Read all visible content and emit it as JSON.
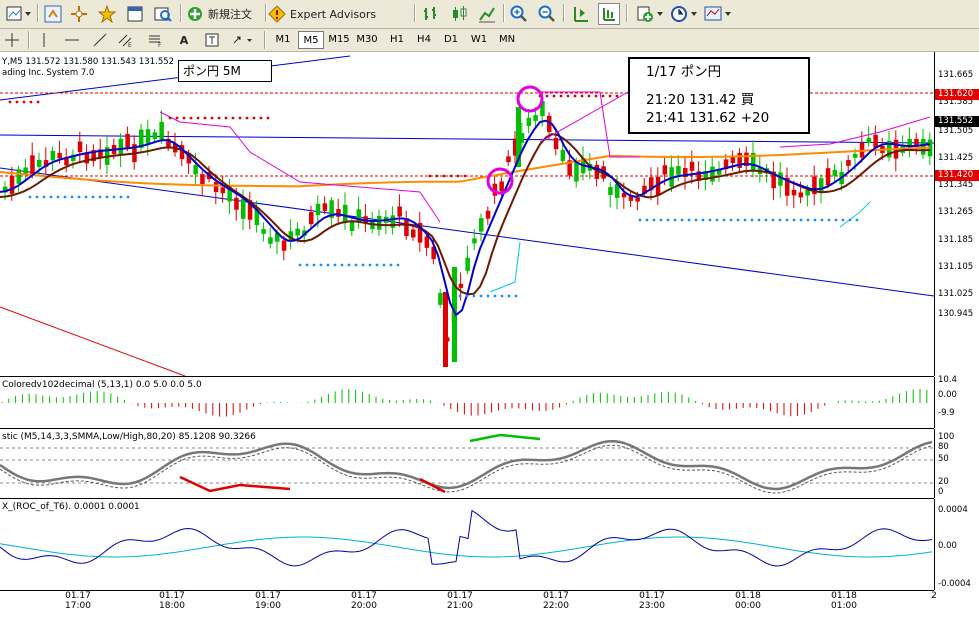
{
  "toolbar": {
    "new_order_label": "新規注文",
    "expert_advisors_label": "Expert Advisors",
    "timeframes": [
      "M1",
      "M5",
      "M15",
      "M30",
      "H1",
      "H4",
      "D1",
      "W1",
      "MN"
    ],
    "active_timeframe": "M5"
  },
  "chart": {
    "header_text": "Y,M5  131.572 131.580 131.543 131.552",
    "subheader_text": "ading Inc. System 7.0",
    "label_box": "ポン円  5M",
    "note_title": "1/17  ポン円",
    "note_line1": "21:20  131.42  買",
    "note_line2": "21:41  131.62  +20",
    "price_axis": [
      "131.665",
      "131.585",
      "131.505",
      "131.425",
      "131.345",
      "131.265",
      "131.185",
      "131.105",
      "131.025",
      "130.945"
    ],
    "price_tags": {
      "upper": "131.620",
      "current": "131.552",
      "lower": "131.420"
    }
  },
  "indicators": {
    "ind1_label": "Coloredv102decimal (5,13,1) 0.0 5.0 0.0 5.0",
    "ind1_axis": [
      "10.4",
      "0.00",
      "-9.9"
    ],
    "ind2_label": "stic (M5,14,3,3,SMMA,Low/High,80,20) 85.1208 90.3266",
    "ind2_axis": [
      "100",
      "80",
      "50",
      "20",
      "0"
    ],
    "ind3_label": "X_(ROC_of_T6). 0.0001 0.0001",
    "ind3_axis": [
      "0.0004",
      "0.00",
      "-0.0004"
    ]
  },
  "time_axis": [
    {
      "date": "01.17",
      "time": "17:00"
    },
    {
      "date": "01.17",
      "time": "18:00"
    },
    {
      "date": "01.17",
      "time": "19:00"
    },
    {
      "date": "01.17",
      "time": "20:00"
    },
    {
      "date": "01.17",
      "time": "21:00"
    },
    {
      "date": "01.17",
      "time": "22:00"
    },
    {
      "date": "01.17",
      "time": "23:00"
    },
    {
      "date": "01.18",
      "time": "00:00"
    },
    {
      "date": "01.18",
      "time": "01:00"
    }
  ],
  "time_axis_edge": "2",
  "colors": {
    "bull": "#00c000",
    "bear": "#e00000",
    "ma_blue": "#0000cc",
    "ma_brown": "#6b1a00",
    "ma_orange": "#ff8c00",
    "magenta": "#e000e0",
    "cyan": "#00c8e8"
  }
}
